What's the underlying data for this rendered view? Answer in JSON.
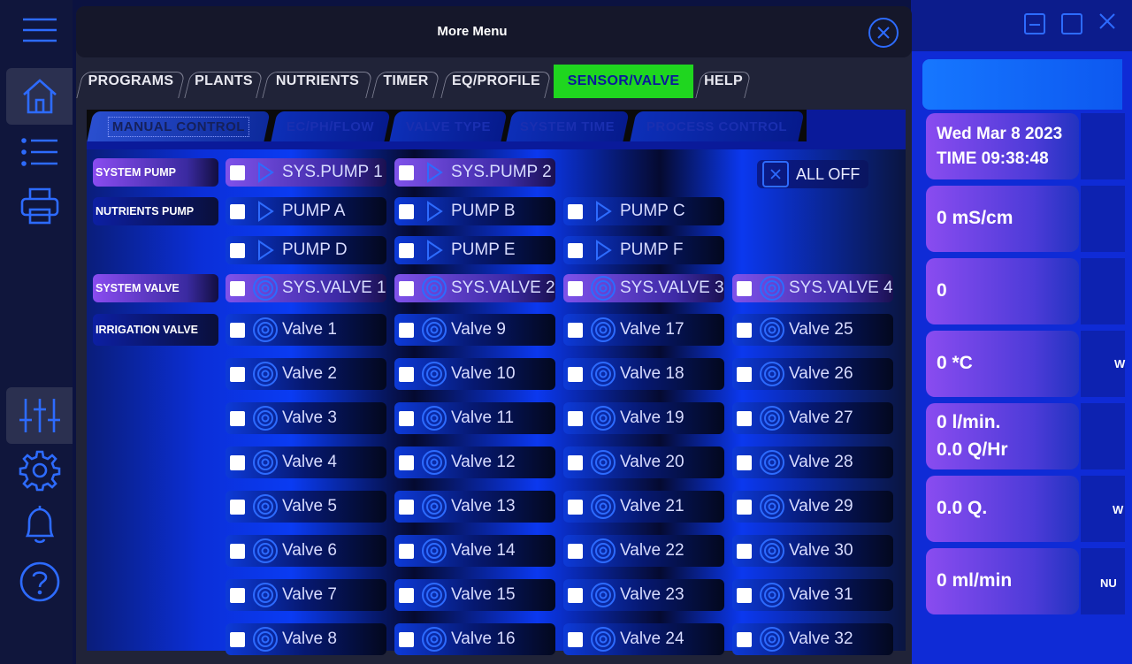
{
  "modal": {
    "title": "More Menu"
  },
  "main_tabs": [
    "PROGRAMS",
    "PLANTS",
    "NUTRIENTS",
    "TIMER",
    "EQ/PROFILE",
    "SENSOR/VALVE",
    "HELP"
  ],
  "active_main_tab": "SENSOR/VALVE",
  "sub_tabs": [
    "MANUAL CONTROL",
    "EC/PH/FLOW",
    "VALVE TYPE",
    "SYSTEM TIME",
    "PROCESS CONTROL"
  ],
  "active_sub_tab": "MANUAL CONTROL",
  "row_labels": {
    "system_pump": "SYSTEM  PUMP",
    "nutrients_pump": "NUTRIENTS PUMP",
    "system_valve": "SYSTEM VALVE",
    "irrigation_valve": "IRRIGATION VALVE"
  },
  "system_pumps": [
    "SYS.PUMP 1",
    "SYS.PUMP 2"
  ],
  "nutrient_pumps": [
    "PUMP A",
    "PUMP B",
    "PUMP C",
    "PUMP D",
    "PUMP E",
    "PUMP F"
  ],
  "system_valves": [
    "SYS.VALVE 1",
    "SYS.VALVE 2",
    "SYS.VALVE 3",
    "SYS.VALVE 4"
  ],
  "all_off_label": "ALL OFF",
  "irrigation_valves": [
    [
      "Valve 1",
      "Valve 9",
      "Valve 17",
      "Valve 25"
    ],
    [
      "Valve 2",
      "Valve 10",
      "Valve 18",
      "Valve 26"
    ],
    [
      "Valve 3",
      "Valve 11",
      "Valve 19",
      "Valve 27"
    ],
    [
      "Valve 4",
      "Valve 12",
      "Valve 20",
      "Valve 28"
    ],
    [
      "Valve 5",
      "Valve 13",
      "Valve 21",
      "Valve 29"
    ],
    [
      "Valve 6",
      "Valve 14",
      "Valve 22",
      "Valve 30"
    ],
    [
      "Valve 7",
      "Valve 15",
      "Valve 23",
      "Valve 31"
    ],
    [
      "Valve 8",
      "Valve 16",
      "Valve 24",
      "Valve 32"
    ]
  ],
  "right_panel": {
    "date": "Wed Mar 8 2023",
    "time": "TIME 09:38:48",
    "ec": "0 mS/cm",
    "ph": "0",
    "temp": "0 *C",
    "flow": "0 l/min.",
    "flow_q": "0.0 Q/Hr",
    "total_q": "0.0 Q.",
    "rate": "0 ml/min",
    "side_labels": [
      "W",
      "W",
      "NU"
    ]
  },
  "colors": {
    "accent": "#2d6bff",
    "active_tab": "#1fd61f",
    "panel_blue": "#0a1a9a"
  },
  "icons": {
    "nav": [
      "menu-icon",
      "home-icon",
      "list-icon",
      "printer-icon",
      "sliders-icon",
      "gear-icon",
      "bell-icon",
      "help-icon"
    ],
    "pump": "play-icon",
    "valve": "valve-icon"
  }
}
